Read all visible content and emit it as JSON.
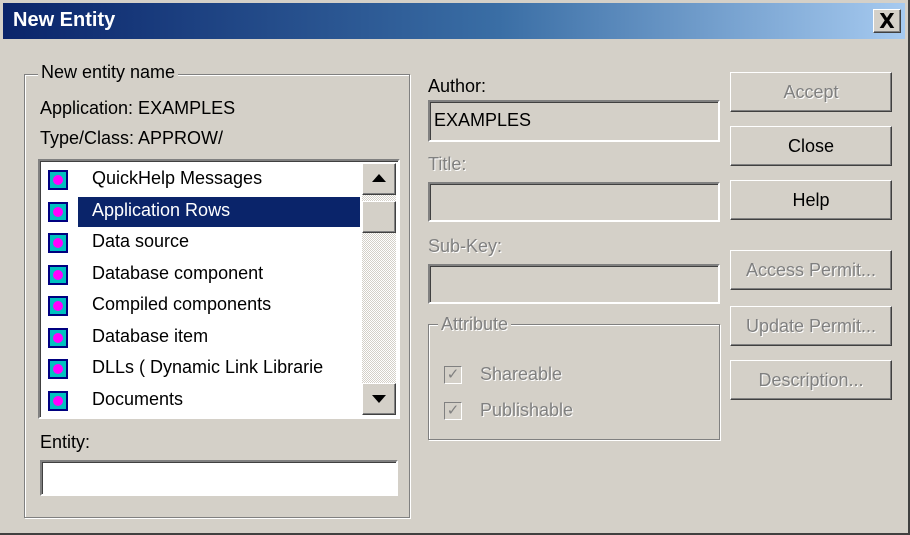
{
  "window": {
    "title": "New Entity",
    "close_glyph": "X"
  },
  "name_group": {
    "legend": "New entity name",
    "application_line": "Application:  EXAMPLES",
    "type_line": "Type/Class: APPROW/",
    "list_items": [
      {
        "icon": "entity-type-icon",
        "label": "QuickHelp Messages"
      },
      {
        "icon": "entity-type-icon",
        "label": "Application Rows",
        "selected": true
      },
      {
        "icon": "entity-type-icon",
        "label": "Data source"
      },
      {
        "icon": "entity-type-icon",
        "label": "Database component"
      },
      {
        "icon": "entity-type-icon",
        "label": "Compiled components"
      },
      {
        "icon": "entity-type-icon",
        "label": "Database item"
      },
      {
        "icon": "entity-type-icon",
        "label": "DLLs ( Dynamic Link Librarie"
      },
      {
        "icon": "entity-type-icon",
        "label": "Documents"
      }
    ],
    "entity_label": "Entity:",
    "entity_value": ""
  },
  "details": {
    "author_label": "Author:",
    "author_value": "EXAMPLES",
    "title_label": "Title:",
    "title_value": "",
    "subkey_label": "Sub-Key:",
    "subkey_value": "",
    "attribute_legend": "Attribute",
    "shareable_label": "Shareable",
    "shareable_checked": true,
    "publishable_label": "Publishable",
    "publishable_checked": true
  },
  "buttons": {
    "accept": "Accept",
    "close": "Close",
    "help": "Help",
    "access_permit": "Access Permit...",
    "update_permit": "Update Permit...",
    "description": "Description..."
  },
  "colors": {
    "title_bar_start": "#0a246a",
    "selection": "#0a246a",
    "dialog_face": "#d4d0c8"
  }
}
